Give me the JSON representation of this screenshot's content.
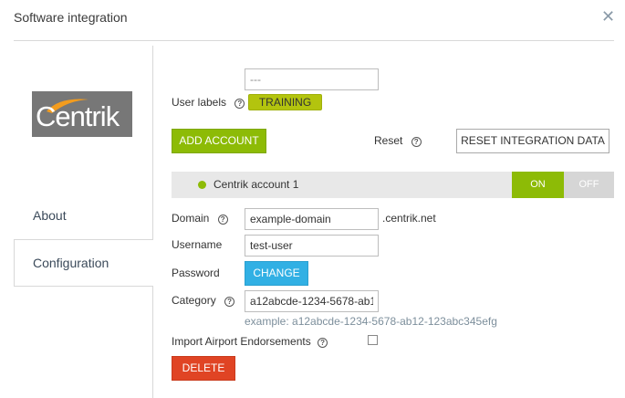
{
  "dialog": {
    "title": "Software integration",
    "close_glyph": "✕"
  },
  "logo": {
    "text": "Centrik",
    "icon": "centrik-logo"
  },
  "nav": {
    "about": "About",
    "configuration": "Configuration"
  },
  "user_labels": {
    "input_value": "---",
    "label": "User labels",
    "tag": "TRAINING"
  },
  "actions": {
    "add_account": "ADD ACCOUNT",
    "reset_label": "Reset",
    "reset_button": "RESET INTEGRATION DATA"
  },
  "account": {
    "name": "Centrik account 1",
    "toggle_on": "ON",
    "toggle_off": "OFF",
    "status_color": "#8dbb06"
  },
  "form": {
    "domain_label": "Domain",
    "domain_value": "example-domain",
    "domain_suffix": ".centrik.net",
    "username_label": "Username",
    "username_value": "test-user",
    "password_label": "Password",
    "password_button": "CHANGE",
    "category_label": "Category",
    "category_value": "a12abcde-1234-5678-ab1",
    "category_example": "example: a12abcde-1234-5678-ab12-123abc345efg",
    "import_label": "Import Airport Endorsements",
    "import_checked": false,
    "delete_button": "DELETE"
  },
  "colors": {
    "accent_green": "#8dbb06",
    "accent_blue": "#31b0e4",
    "danger_red": "#e04424",
    "tag_yellow": "#b3c40e"
  }
}
